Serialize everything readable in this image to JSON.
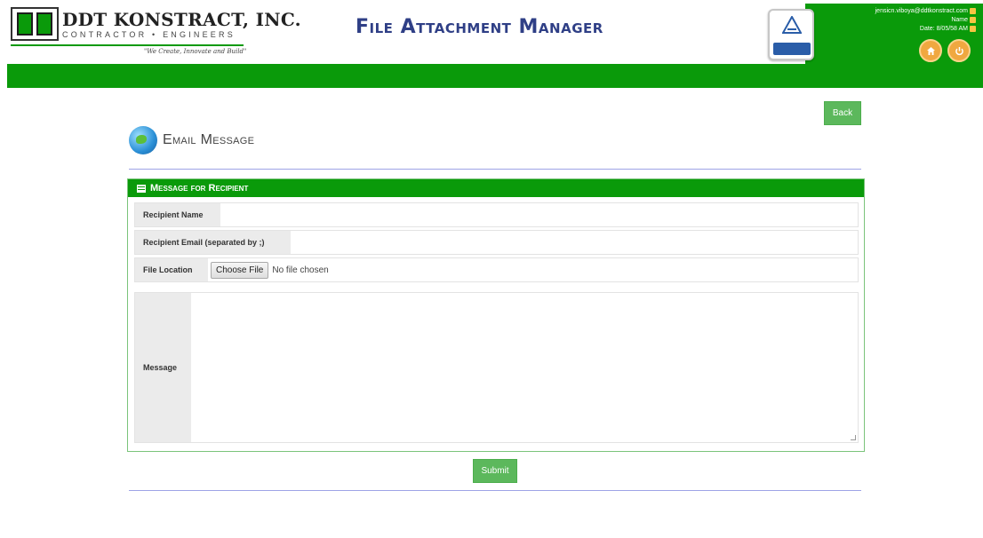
{
  "company": {
    "name": "DDT KONSTRACT, INC.",
    "subtitle": "CONTRACTOR • ENGINEERS",
    "tagline": "\"We Create, Innovate and Build\""
  },
  "header": {
    "app_title": "File Attachment Manager",
    "user_email": "jensicn.viboya@ddtkonstract.com",
    "user_name": "Name",
    "date_label": "Date: 8/05/58 AM"
  },
  "toolbar": {
    "back_label": "Back"
  },
  "page": {
    "title": "Email Message"
  },
  "panel": {
    "title": "Message for Recipient",
    "recipient_name_label": "Recipient Name",
    "recipient_name_value": "",
    "recipient_email_label": "Recipient Email (separated by ;)",
    "recipient_email_value": "",
    "file_location_label": "File Location",
    "choose_file_label": "Choose File",
    "no_file_text": "No file chosen",
    "message_label": "Message",
    "message_value": ""
  },
  "actions": {
    "submit_label": "Submit"
  },
  "icons": {
    "home": "home-icon",
    "power": "power-icon",
    "user": "user-icon",
    "calendar": "calendar-icon",
    "globe": "globe-icon",
    "list": "list-icon"
  },
  "colors": {
    "brand_green": "#0a9a0a",
    "button_green": "#5cb85c",
    "title_blue": "#2f3f86",
    "accent_orange": "#f0a840"
  }
}
